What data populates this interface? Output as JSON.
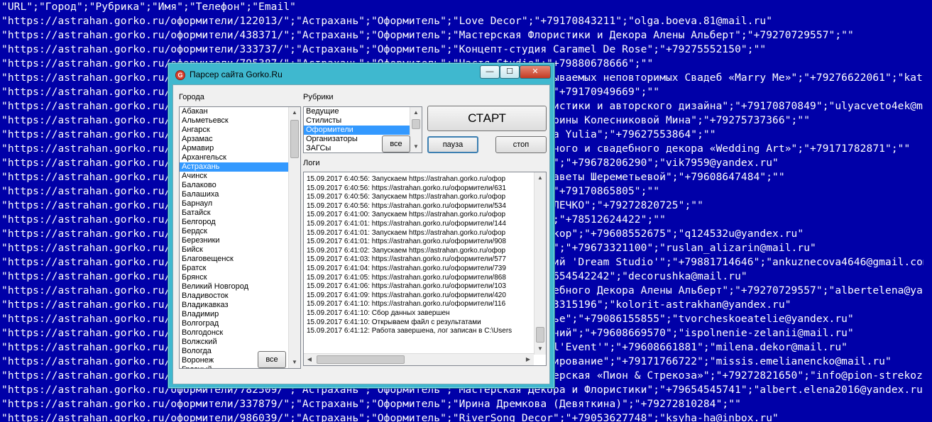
{
  "background": {
    "lines": [
      "\"URL\";\"Город\";\"Рубрика\";\"Имя\";\"Телефон\";\"Email\"",
      "\"https://astrahan.gorko.ru/оформители/122013/\";\"Астрахань\";\"Оформитель\";\"Love Decor\";\"+79170843211\";\"olga.boeva.81@mail.ru\"",
      "\"https://astrahan.gorko.ru/оформители/438371/\";\"Астрахань\";\"Оформитель\";\"Мастерская Флористики и Декора Алены Альберт\";\"+79270729557\";\"\"",
      "\"https://astrahan.gorko.ru/оформители/333737/\";\"Астрахань\";\"Оформитель\";\"Концепт-студия Caramel De Rose\";\"+79275552150\";\"\"",
      "\"https://astrahan.gorko.ru/оформители/795387/\";\"Астрахань\";\"Оформитель\";\"Настя Studio\";\"+79880678666\";\"\"",
      "\"https://astrahan.gorko.ru/оформители/416455/\";\"Астрахань\";\"Оформитель\";\"Агентство незабываемых неповторимых Свадеб «Marry Me»\";\"+79276622061\";\"katy999-222@mail.ru\"",
      "\"https://astrahan.gorko.ru/оформители/631040/\";\"Астрахань\";\"Оформитель\";\"Декорирование\";\"+79170949669\";\"\"",
      "\"https://astrahan.gorko.ru/оформители/534002/\";\"Астрахань\";\"Оформитель\";\"Мастерская флористики и авторского дизайна\";\"+79170870849\";\"ulyacveto4ek@mail.ru\"",
      "\"https://astrahan.gorko.ru/оформители/144119/\";\"Астрахань\";\"Оформитель\";\"Студия декора Ирины Колесниковой Мина\";\"+79275737366\";\"\"",
      "\"https://astrahan.gorko.ru/оформители/908126/\";\"Астрахань\";\"Оформитель\";\"Flower Studio Ya Yulia\";\"+79627553864\";\"\"",
      "\"https://astrahan.gorko.ru/оформители/577301/\";\"Астрахань\";\"Оформитель\";\"Студия праздничного и свадебного декора «Wedding Art»\";\"+79171782871\";\"\"",
      "\"https://astrahan.gorko.ru/оформители/739124/\";\"Астрахань\";\"Оформитель\";\"Декор для своих\";\"+79678206290\";\"vik7959@yandex.ru\"",
      "\"https://astrahan.gorko.ru/оформители/868512/\";\"Астрахань\";\"Оформитель\";\"Мастерская Елизаветы Шереметьевой\";\"+79608647484\";\"\"",
      "\"https://astrahan.gorko.ru/оформители/103775/\";\"Астрахань\";\"Оформитель\";\"Студия Апрель\";\"+79170865805\";\"\"",
      "\"https://astrahan.gorko.ru/оформители/420518/\";\"Астрахань\";\"Оформитель\";\"Декор-студия КОЛЕЧКО\";\"+79272820725\";\"\"",
      "\"https://astrahan.gorko.ru/оформители/116092/\";\"Астрахань\";\"Оформитель\";\"Декор Ateliere\";\"+78512624422\";\"\"",
      "\"https://astrahan.gorko.ru/оформители/225731/\";\"Астрахань\";\"Оформитель\";\"Флористика и декор\";\"+79608552675\";\"q124532u@yandex.ru\"",
      "\"https://astrahan.gorko.ru/оформители/661845/\";\"Астрахань\";\"Оформитель\";\"Студия Ализарин\";\"+79673321100\";\"ruslan_alizarin@mail.ru\"",
      "\"https://astrahan.gorko.ru/оформители/392117/\";\"Астрахань\";\"Оформитель\";\"Агентство событий 'Dream Studio'\";\"+79881714646\";\"ankuznecova4646@gmail.com\"",
      "\"https://astrahan.gorko.ru/оформители/850244/\";\"Астрахань\";\"Оформитель\";\"Декорушка\";\"+79654542242\";\"decorushka@mail.ru\"",
      "\"https://astrahan.gorko.ru/оформители/297063/\";\"Астрахань\";\"Оформитель\";\"Мастерская Свадебного Декора Алены Альберт\";\"+79270729557\";\"albertelena@yandex.ru\"",
      "\"https://astrahan.gorko.ru/оформители/741390/\";\"Астрахань\";\"Оформитель\";\"Колорит\";\"+79673315196\";\"kolorit-astrakhan@yandex.ru\"",
      "\"https://astrahan.gorko.ru/оформители/563208/\";\"Астрахань\";\"Оформитель\";\"Творческое ателье\";\"+79086155855\";\"tvorcheskoeatelie@yandex.ru\"",
      "\"https://astrahan.gorko.ru/оформители/318476/\";\"Астрахань\";\"Оформитель\";\"Исполнение желаний\";\"+79608669570\";\"ispolnenie-zelanii@mail.ru\"",
      "\"https://astrahan.gorko.ru/оформители/904157/\";\"Астрахань\";\"Оформитель\";\"Декор-студия 'Il'Event'\";\"+79608661881\";\"milena.dekor@mail.ru\"",
      "\"https://astrahan.gorko.ru/оформители/476920/\";\"Астрахань\";\"Оформитель\";\"Свадебное декорирование\";\"+79171766722\";\"missis.emelianencko@mail.ru\"",
      "\"https://astrahan.gorko.ru/оформители/215683/\";\"Астрахань\";\"Оформитель\";\"Творческая мастерская «Пион & Стрекоза»\";\"+79272821650\";\"info@pion-strekoza.ru\"",
      "\"https://astrahan.gorko.ru/оформители/782509/\";\"Астрахань\";\"Оформитель\";\"Мастерская Декора и Флористики\";\"+79654545741\";\"albert.elena2016@yandex.ru\"",
      "\"https://astrahan.gorko.ru/оформители/337879/\";\"Астрахань\";\"Оформитель\";\"Ирина Дремкова (Девяткина)\";\"+79272810284\";\"\"",
      "\"https://astrahan.gorko.ru/оформители/986039/\";\"Астрахань\";\"Оформитель\";\"RiverSong Decor\";\"+79053627748\";\"ksyha-ha@inbox.ru\""
    ]
  },
  "window": {
    "title": "Парсер сайта Gorko.Ru",
    "icon_glyph": "G",
    "controls": {
      "minimize": "—",
      "maximize": "☐",
      "close": "✕"
    }
  },
  "cities": {
    "label": "Города",
    "items": [
      "Абакан",
      "Альметьевск",
      "Ангарск",
      "Арзамас",
      "Армавир",
      "Архангельск",
      "Астрахань",
      "Ачинск",
      "Балаково",
      "Балашиха",
      "Барнаул",
      "Батайск",
      "Белгород",
      "Бердск",
      "Березники",
      "Бийск",
      "Благовещенск",
      "Братск",
      "Брянск",
      "Великий Новгород",
      "Владивосток",
      "Владикавказ",
      "Владимир",
      "Волгоград",
      "Волгодонск",
      "Волжский",
      "Вологда",
      "Воронеж",
      "Грозный"
    ],
    "selected": "Астрахань",
    "all_button": "все"
  },
  "rubrics": {
    "label": "Рубрики",
    "items": [
      "Ведущие",
      "Стилисты",
      "Оформители",
      "Организаторы",
      "ЗАГСы"
    ],
    "selected": "Оформители",
    "all_button": "все"
  },
  "buttons": {
    "start": "СТАРТ",
    "pause": "пауза",
    "stop": "стоп"
  },
  "logs": {
    "label": "Логи",
    "lines": [
      "15.09.2017 6:40:56: Запускаем https://astrahan.gorko.ru/офор",
      "15.09.2017 6:40:56: https://astrahan.gorko.ru/оформители/631",
      "15.09.2017 6:40:56: Запускаем https://astrahan.gorko.ru/офор",
      "15.09.2017 6:40:56: https://astrahan.gorko.ru/оформители/534",
      "15.09.2017 6:41:00: Запускаем https://astrahan.gorko.ru/офор",
      "15.09.2017 6:41:01: https://astrahan.gorko.ru/оформители/144",
      "15.09.2017 6:41:01: Запускаем https://astrahan.gorko.ru/офор",
      "15.09.2017 6:41:01: https://astrahan.gorko.ru/оформители/908",
      "15.09.2017 6:41:02: Запускаем https://astrahan.gorko.ru/офор",
      "15.09.2017 6:41:03: https://astrahan.gorko.ru/оформители/577",
      "15.09.2017 6:41:04: https://astrahan.gorko.ru/оформители/739",
      "15.09.2017 6:41:05: https://astrahan.gorko.ru/оформители/868",
      "15.09.2017 6:41:06: https://astrahan.gorko.ru/оформители/103",
      "15.09.2017 6:41:09: https://astrahan.gorko.ru/оформители/420",
      "15.09.2017 6:41:10: https://astrahan.gorko.ru/оформители/116",
      "15.09.2017 6:41:10: Сбор данных завершен",
      "15.09.2017 6:41:10: Открываем файл с результатами",
      "15.09.2017 6:41:12: Работа завершена, лог записан в C:\\Users"
    ]
  },
  "colors": {
    "background": "#0000a8",
    "window_frame": "#3fb8cf",
    "selection": "#3399ff",
    "close_button": "#c43b22"
  }
}
